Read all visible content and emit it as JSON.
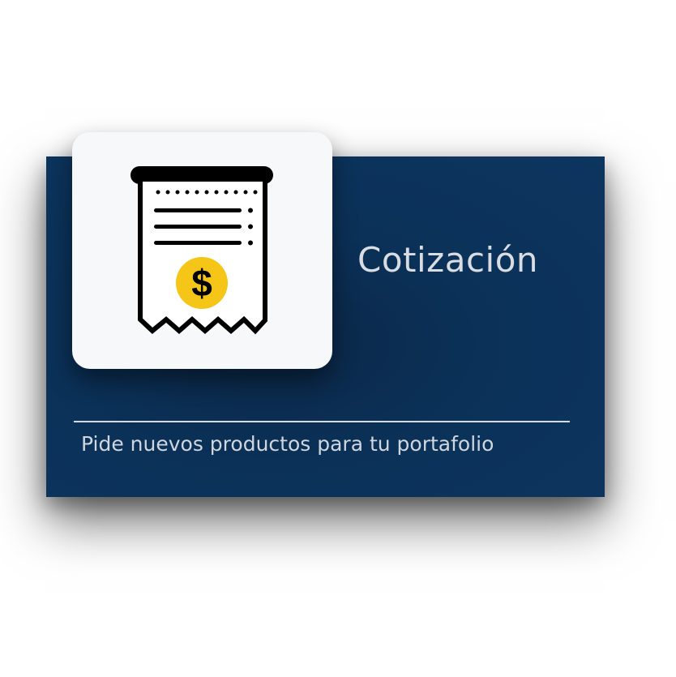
{
  "card": {
    "title": "Cotización",
    "subtitle": "Pide nuevos productos para tu portafolio",
    "icon": "receipt-dollar-icon"
  },
  "colors": {
    "card_background": "#0c355f",
    "tile_background": "#f6f8fa",
    "coin": "#f5c518",
    "title_text": "#d9dde2"
  }
}
